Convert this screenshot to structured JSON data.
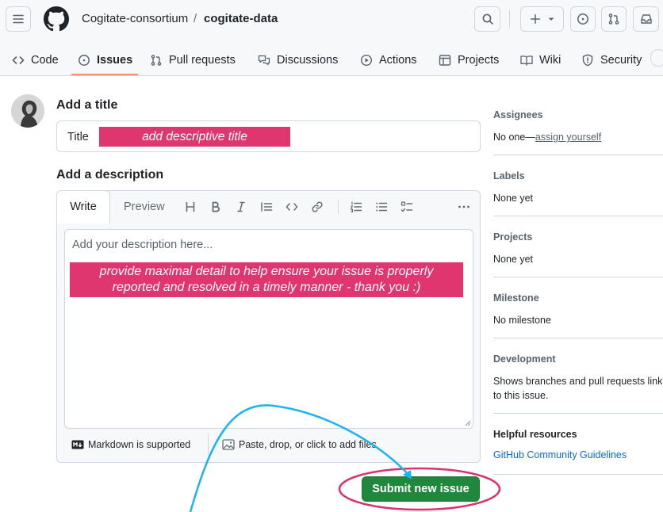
{
  "header": {
    "owner": "Cogitate-consortium",
    "separator": "/",
    "repo": "cogitate-data"
  },
  "tabs": [
    {
      "label": "Code",
      "icon": "code-icon"
    },
    {
      "label": "Issues",
      "icon": "issue-opened-icon",
      "active": true
    },
    {
      "label": "Pull requests",
      "icon": "git-pull-request-icon"
    },
    {
      "label": "Discussions",
      "icon": "comment-discussion-icon"
    },
    {
      "label": "Actions",
      "icon": "play-icon"
    },
    {
      "label": "Projects",
      "icon": "table-icon"
    },
    {
      "label": "Wiki",
      "icon": "book-icon"
    },
    {
      "label": "Security",
      "icon": "shield-icon"
    }
  ],
  "form": {
    "title_heading": "Add a title",
    "title_label": "Title",
    "title_annotation": "add descriptive title",
    "description_heading": "Add a description",
    "write_tab": "Write",
    "preview_tab": "Preview",
    "description_placeholder": "Add your description here...",
    "description_annotation_line1": "provide maximal detail to help ensure your issue is properly",
    "description_annotation_line2": "reported and resolved in a timely manner - thank you :)",
    "markdown_note": "Markdown is supported",
    "attach_note": "Paste, drop, or click to add files",
    "submit_label": "Submit new issue"
  },
  "sidebar": {
    "assignees": {
      "heading": "Assignees",
      "value_prefix": "No one—",
      "value_link": "assign yourself"
    },
    "labels": {
      "heading": "Labels",
      "value": "None yet"
    },
    "projects": {
      "heading": "Projects",
      "value": "None yet"
    },
    "milestone": {
      "heading": "Milestone",
      "value": "No milestone"
    },
    "development": {
      "heading": "Development",
      "value_line1": "Shows branches and pull requests link",
      "value_line2": "to this issue."
    },
    "resources": {
      "heading": "Helpful resources",
      "link": "GitHub Community Guidelines"
    }
  },
  "colors": {
    "annotation_pink": "#e0366f",
    "annotation_arrow": "#1ab4f0",
    "submit_green": "#1f883d",
    "active_tab_underline": "#fd8c73",
    "link_blue": "#0969da"
  }
}
